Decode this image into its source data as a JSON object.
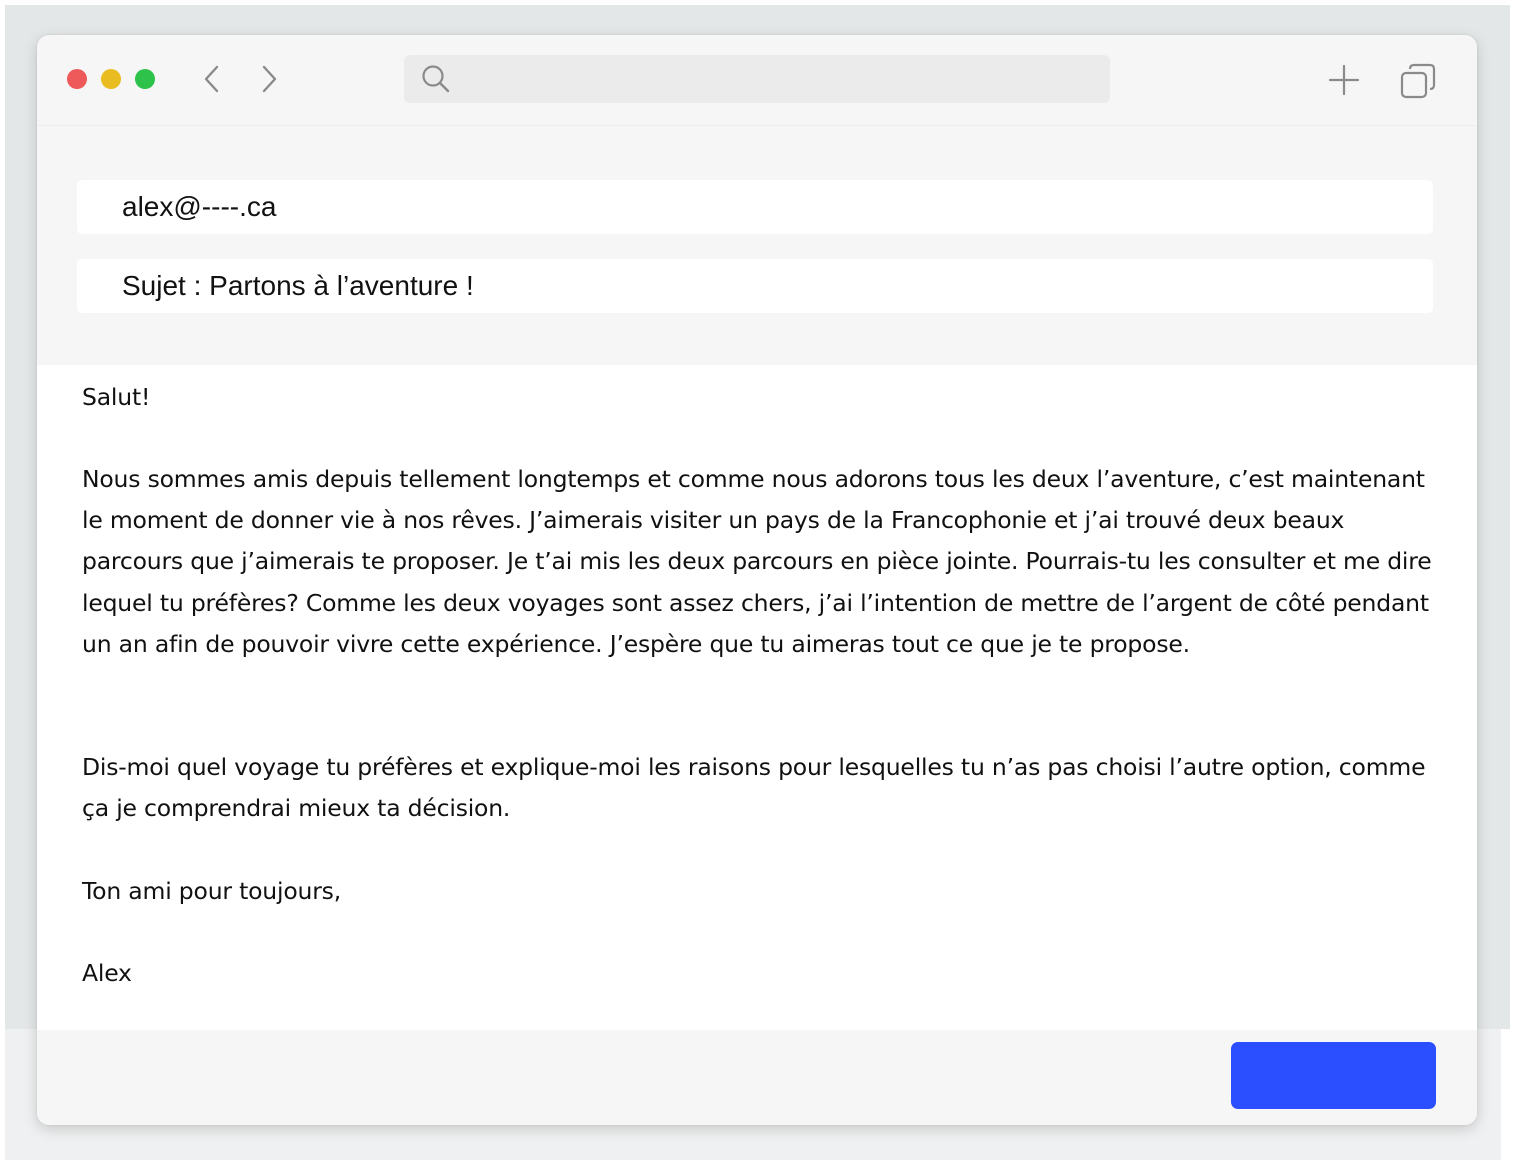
{
  "colors": {
    "close": "#ee5a5a",
    "minimize": "#e9bd22",
    "maximize": "#2fc24b",
    "send_button": "#2b4fff",
    "window": "#f6f6f6",
    "backdrop": "#e4e7e8"
  },
  "toolbar": {
    "icons": [
      "back-icon",
      "forward-icon",
      "search-icon",
      "plus-icon",
      "tabs-icon"
    ],
    "address": {
      "value": "",
      "placeholder": ""
    }
  },
  "email": {
    "to": "alex@----.ca",
    "subject": "Sujet : Partons à l’aventure !"
  },
  "message": {
    "greeting": "Salut!",
    "paragraph1": "Nous sommes amis depuis tellement longtemps et comme nous adorons tous les deux l’aventure, c’est maintenant le moment de donner vie à nos rêves. J’aimerais visiter un pays de la Francophonie et j’ai trouvé deux beaux parcours que j’aimerais te proposer. Je t’ai mis les deux parcours en pièce jointe. Pourrais-tu les consulter et me dire lequel tu préfères? Comme les deux voyages sont assez chers, j’ai l’intention de mettre de l’argent de côté pendant un an afin de pouvoir vivre cette expérience. J’espère que tu aimeras tout ce que je te propose.",
    "paragraph2": "Dis-moi quel voyage tu préfères et explique-moi les raisons pour lesquelles tu n’as pas choisi l’autre option, comme ça je comprendrai mieux ta décision.",
    "closing": "Ton ami pour toujours,",
    "signature": "Alex"
  },
  "footer": {
    "send_label": ""
  }
}
